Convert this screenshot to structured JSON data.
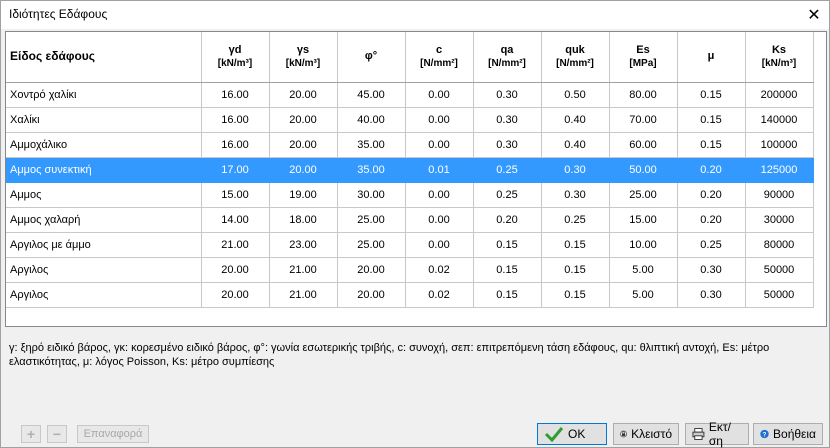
{
  "window": {
    "title": "Ιδιότητες Εδάφους",
    "close_glyph": "✕"
  },
  "table": {
    "headers": [
      {
        "name": "Είδος εδάφους",
        "unit": ""
      },
      {
        "name": "γd",
        "unit": "[kN/m³]"
      },
      {
        "name": "γs",
        "unit": "[kN/m³]"
      },
      {
        "name": "φ°",
        "unit": ""
      },
      {
        "name": "c",
        "unit": "[N/mm²]"
      },
      {
        "name": "qa",
        "unit": "[N/mm²]"
      },
      {
        "name": "quk",
        "unit": "[N/mm²]"
      },
      {
        "name": "Es",
        "unit": "[MPa]"
      },
      {
        "name": "μ",
        "unit": ""
      },
      {
        "name": "Ks",
        "unit": "[kN/m³]"
      }
    ],
    "selected_row": 3,
    "rows": [
      [
        "Χοντρό χαλίκι",
        "16.00",
        "20.00",
        "45.00",
        "0.00",
        "0.30",
        "0.50",
        "80.00",
        "0.15",
        "200000"
      ],
      [
        "Χαλίκι",
        "16.00",
        "20.00",
        "40.00",
        "0.00",
        "0.30",
        "0.40",
        "70.00",
        "0.15",
        "140000"
      ],
      [
        "Αμμοχάλικο",
        "16.00",
        "20.00",
        "35.00",
        "0.00",
        "0.30",
        "0.40",
        "60.00",
        "0.15",
        "100000"
      ],
      [
        "Αμμος συνεκτική",
        "17.00",
        "20.00",
        "35.00",
        "0.01",
        "0.25",
        "0.30",
        "50.00",
        "0.20",
        "125000"
      ],
      [
        "Αμμος",
        "15.00",
        "19.00",
        "30.00",
        "0.00",
        "0.25",
        "0.30",
        "25.00",
        "0.20",
        "90000"
      ],
      [
        "Αμμος χαλαρή",
        "14.00",
        "18.00",
        "25.00",
        "0.00",
        "0.20",
        "0.25",
        "15.00",
        "0.20",
        "30000"
      ],
      [
        "Αργιλος με άμμο",
        "21.00",
        "23.00",
        "25.00",
        "0.00",
        "0.15",
        "0.15",
        "10.00",
        "0.25",
        "80000"
      ],
      [
        "Αργιλος",
        "20.00",
        "21.00",
        "20.00",
        "0.02",
        "0.15",
        "0.15",
        "5.00",
        "0.30",
        "50000"
      ],
      [
        "Αργιλος",
        "20.00",
        "21.00",
        "20.00",
        "0.02",
        "0.15",
        "0.15",
        "5.00",
        "0.30",
        "50000"
      ]
    ]
  },
  "legend": "γ: ξηρό ειδικό βάρος, γκ: κορεσμένο ειδικό βάρος, φ°: γωνία εσωτερικής τριβής, c: συνοχή, σεπ: επιτρεπόμενη τάση εδάφους, qu: θλιπτική αντοχή, Es: μέτρο ελαστικότητας, μ: λόγος Poisson, Ks: μέτρο συμπίεσης",
  "footer": {
    "add_glyph": "+",
    "remove_glyph": "−",
    "restore_label": "Επαναφορά",
    "ok_label": "OK",
    "lock_label": "Κλειστό",
    "print_label": "Εκτ/ση",
    "help_label": "Βοήθεια"
  },
  "colors": {
    "selection": "#3399ff",
    "ok_check": "#2e9e2e",
    "help_icon": "#1f6fd1"
  }
}
